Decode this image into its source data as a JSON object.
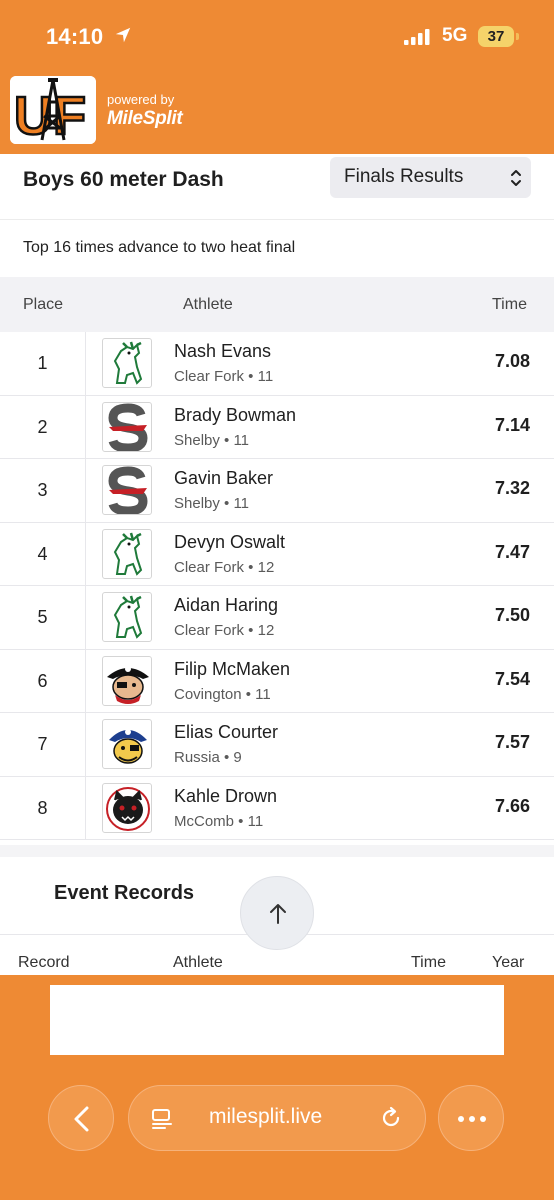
{
  "status_bar": {
    "time": "14:10",
    "network": "5G",
    "battery": "37"
  },
  "header": {
    "logo_text": "UF",
    "powered_by": "powered by",
    "brand": "MileSplit"
  },
  "event": {
    "title": "Boys 60 meter Dash",
    "round_selected": "Finals Results",
    "note": "Top 16 times advance to two heat final"
  },
  "results": {
    "columns": [
      "Place",
      "Athlete",
      "Time"
    ],
    "rows": [
      {
        "place": "1",
        "name": "Nash Evans",
        "meta": "Clear Fork • 11",
        "time": "7.08",
        "team_logo": "mustang-icon"
      },
      {
        "place": "2",
        "name": "Brady Bowman",
        "meta": "Shelby • 11",
        "time": "7.14",
        "team_logo": "shelby-s-icon"
      },
      {
        "place": "3",
        "name": "Gavin Baker",
        "meta": "Shelby • 11",
        "time": "7.32",
        "team_logo": "shelby-s-icon"
      },
      {
        "place": "4",
        "name": "Devyn Oswalt",
        "meta": "Clear Fork • 12",
        "time": "7.47",
        "team_logo": "mustang-icon"
      },
      {
        "place": "5",
        "name": "Aidan Haring",
        "meta": "Clear Fork • 12",
        "time": "7.50",
        "team_logo": "mustang-icon"
      },
      {
        "place": "6",
        "name": "Filip McMaken",
        "meta": "Covington • 11",
        "time": "7.54",
        "team_logo": "pirate-icon"
      },
      {
        "place": "7",
        "name": "Elias Courter",
        "meta": "Russia • 9",
        "time": "7.57",
        "team_logo": "pirate-blue-icon"
      },
      {
        "place": "8",
        "name": "Kahle Drown",
        "meta": "McComb • 11",
        "time": "7.66",
        "team_logo": "panther-icon"
      }
    ]
  },
  "records": {
    "title": "Event Records",
    "columns": [
      "Record",
      "Athlete",
      "Time",
      "Year"
    ]
  },
  "browser": {
    "url": "milesplit.live"
  },
  "colors": {
    "brand_orange": "#ee8a34",
    "clear_fork_green": "#1f7a3a",
    "shelby_red": "#c62026"
  }
}
